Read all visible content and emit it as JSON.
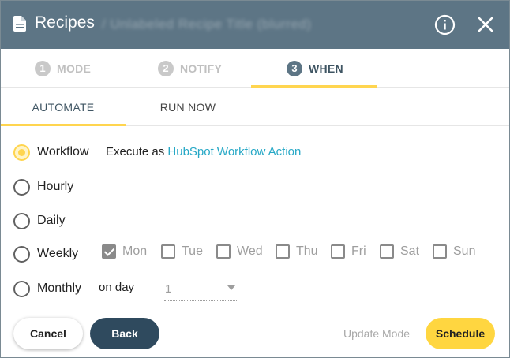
{
  "header": {
    "title": "Recipes",
    "subtitle": "/ Unlabeled Recipe Title (blurred)",
    "icons": {
      "doc": "document-icon",
      "info": "info-icon",
      "close": "close-icon"
    }
  },
  "stepper": {
    "steps": [
      {
        "num": "1",
        "label": "MODE",
        "active": false
      },
      {
        "num": "2",
        "label": "NOTIFY",
        "active": false
      },
      {
        "num": "3",
        "label": "WHEN",
        "active": true
      }
    ]
  },
  "tabs": [
    {
      "label": "AUTOMATE",
      "active": true
    },
    {
      "label": "RUN NOW",
      "active": false
    }
  ],
  "options": {
    "workflow": {
      "label": "Workflow",
      "selected": true,
      "exec_prefix": "Execute as",
      "exec_link": "HubSpot Workflow Action"
    },
    "hourly": {
      "label": "Hourly",
      "selected": false
    },
    "daily": {
      "label": "Daily",
      "selected": false
    },
    "weekly": {
      "label": "Weekly",
      "selected": false,
      "days": [
        {
          "label": "Mon",
          "checked": true
        },
        {
          "label": "Tue",
          "checked": false
        },
        {
          "label": "Wed",
          "checked": false
        },
        {
          "label": "Thu",
          "checked": false
        },
        {
          "label": "Fri",
          "checked": false
        },
        {
          "label": "Sat",
          "checked": false
        },
        {
          "label": "Sun",
          "checked": false
        }
      ]
    },
    "monthly": {
      "label": "Monthly",
      "selected": false,
      "on_day_label": "on day",
      "day_value": "1"
    }
  },
  "buttons": {
    "cancel": "Cancel",
    "back": "Back",
    "update_mode": "Update Mode",
    "schedule": "Schedule"
  },
  "colors": {
    "header_bg": "#5d7585",
    "accent": "#ffd54f",
    "link": "#26a8c6",
    "back_button": "#2f4a5e",
    "schedule_button": "#ffd640"
  }
}
